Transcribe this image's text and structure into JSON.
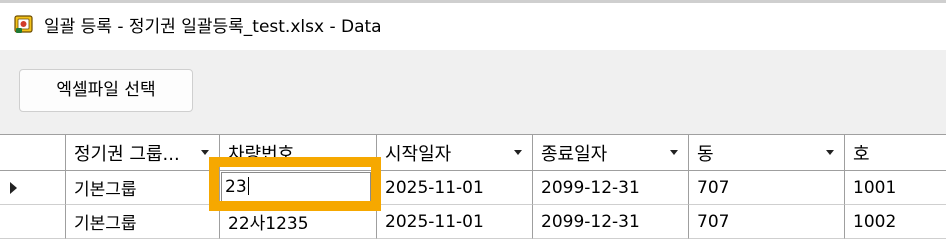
{
  "window": {
    "title": "일괄 등록 - 정기권 일괄등록_test.xlsx - Data",
    "app_icon": "excel-app-icon"
  },
  "toolbar": {
    "select_excel_label": "엑셀파일 선택"
  },
  "grid": {
    "columns": [
      {
        "label": "정기권 그룹...",
        "has_dropdown": true
      },
      {
        "label": "차량번호",
        "has_dropdown": false
      },
      {
        "label": "시작일자",
        "has_dropdown": true
      },
      {
        "label": "종료일자",
        "has_dropdown": true
      },
      {
        "label": "동",
        "has_dropdown": true
      },
      {
        "label": "호",
        "has_dropdown": false
      }
    ],
    "rows": [
      {
        "current": true,
        "cells": [
          "기본그룹",
          "23",
          "2025-11-01",
          "2099-12-31",
          "707",
          "1001"
        ]
      },
      {
        "current": false,
        "cells": [
          "기본그룹",
          "22사1235",
          "2025-11-01",
          "2099-12-31",
          "707",
          "1002"
        ]
      }
    ],
    "editing_value": "23"
  },
  "colors": {
    "highlight": "#f6a800",
    "grid_line": "#9f9f9f",
    "window_bg": "#f0f0f0"
  }
}
